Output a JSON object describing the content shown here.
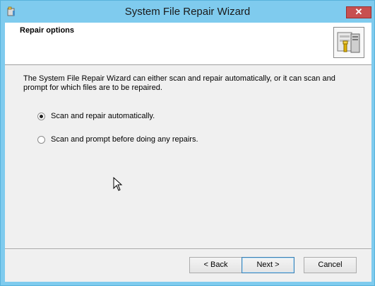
{
  "window": {
    "title": "System File Repair Wizard",
    "close_label": "✕"
  },
  "header": {
    "title": "Repair options"
  },
  "content": {
    "description": "The System File Repair Wizard can either scan and repair automatically, or it can scan and prompt for which files are to be repaired.",
    "options": [
      {
        "label": "Scan and repair automatically.",
        "selected": true
      },
      {
        "label": "Scan and prompt before doing any repairs.",
        "selected": false
      }
    ]
  },
  "buttons": {
    "back": "< Back",
    "next": "Next >",
    "cancel": "Cancel"
  }
}
